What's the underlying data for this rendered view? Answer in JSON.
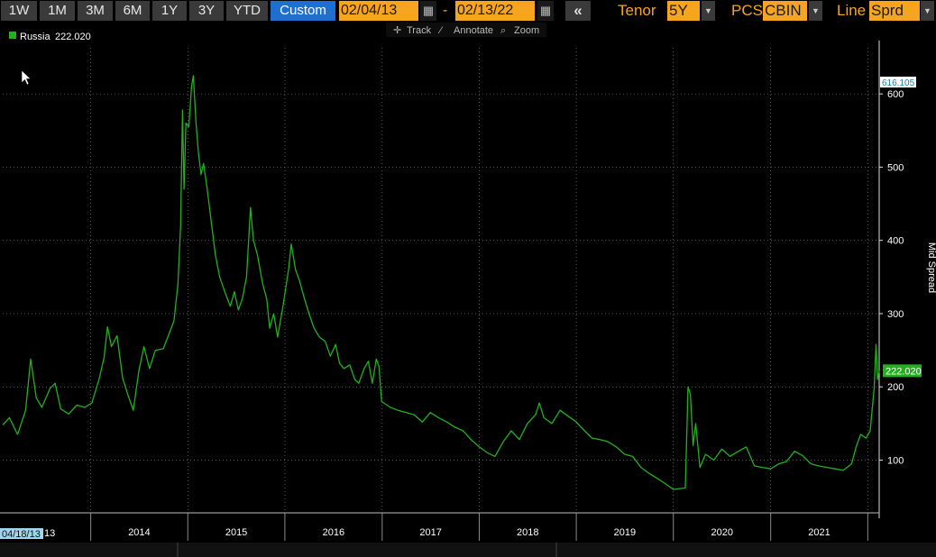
{
  "toolbar": {
    "ranges": [
      "1W",
      "1M",
      "3M",
      "6M",
      "1Y",
      "3Y",
      "YTD",
      "Custom"
    ],
    "active_range": "Custom",
    "start_date": "02/04/13",
    "end_date": "02/13/22",
    "date_separator": "-",
    "tenor_label": "Tenor",
    "tenor_value": "5Y",
    "pcs_label": "PCS",
    "pcs_value": "CBIN",
    "line_label": "Line",
    "line_value": "Sprd",
    "back_glyph": "«",
    "calendar_icon": "calendar-icon",
    "dropdown_icon": "chevron-down-icon"
  },
  "chart_tools": {
    "track": "Track",
    "annotate": "Annotate",
    "zoom": "Zoom"
  },
  "colors": {
    "series": "#22b01e",
    "accent": "#f7a51f",
    "active": "#1f6fd1",
    "background": "#000000"
  },
  "chart_data": {
    "type": "line",
    "series": [
      {
        "name": "Russia",
        "last_value_label": "222.020",
        "points": [
          [
            "2013-02-04",
            148
          ],
          [
            "2013-03-01",
            158
          ],
          [
            "2013-04-01",
            135
          ],
          [
            "2013-05-01",
            168
          ],
          [
            "2013-05-20",
            238
          ],
          [
            "2013-06-10",
            185
          ],
          [
            "2013-07-01",
            172
          ],
          [
            "2013-08-01",
            198
          ],
          [
            "2013-08-20",
            205
          ],
          [
            "2013-09-10",
            170
          ],
          [
            "2013-10-10",
            163
          ],
          [
            "2013-11-10",
            175
          ],
          [
            "2013-12-10",
            172
          ],
          [
            "2014-01-05",
            178
          ],
          [
            "2014-02-01",
            210
          ],
          [
            "2014-02-20",
            240
          ],
          [
            "2014-03-05",
            282
          ],
          [
            "2014-03-20",
            255
          ],
          [
            "2014-04-10",
            270
          ],
          [
            "2014-05-01",
            212
          ],
          [
            "2014-05-20",
            190
          ],
          [
            "2014-06-10",
            168
          ],
          [
            "2014-07-01",
            222
          ],
          [
            "2014-07-20",
            255
          ],
          [
            "2014-08-10",
            225
          ],
          [
            "2014-09-01",
            250
          ],
          [
            "2014-10-01",
            252
          ],
          [
            "2014-10-20",
            270
          ],
          [
            "2014-11-10",
            290
          ],
          [
            "2014-11-25",
            340
          ],
          [
            "2014-12-05",
            420
          ],
          [
            "2014-12-12",
            578
          ],
          [
            "2014-12-18",
            470
          ],
          [
            "2014-12-25",
            560
          ],
          [
            "2015-01-05",
            555
          ],
          [
            "2015-01-15",
            610
          ],
          [
            "2015-01-22",
            625
          ],
          [
            "2015-02-01",
            560
          ],
          [
            "2015-02-10",
            520
          ],
          [
            "2015-02-20",
            490
          ],
          [
            "2015-03-01",
            505
          ],
          [
            "2015-03-15",
            470
          ],
          [
            "2015-04-01",
            420
          ],
          [
            "2015-04-15",
            380
          ],
          [
            "2015-05-01",
            350
          ],
          [
            "2015-05-20",
            330
          ],
          [
            "2015-06-10",
            310
          ],
          [
            "2015-06-25",
            330
          ],
          [
            "2015-07-10",
            305
          ],
          [
            "2015-07-25",
            320
          ],
          [
            "2015-08-10",
            350
          ],
          [
            "2015-08-25",
            445
          ],
          [
            "2015-09-05",
            400
          ],
          [
            "2015-09-20",
            380
          ],
          [
            "2015-10-10",
            340
          ],
          [
            "2015-10-25",
            320
          ],
          [
            "2015-11-05",
            280
          ],
          [
            "2015-11-20",
            300
          ],
          [
            "2015-12-05",
            268
          ],
          [
            "2015-12-25",
            310
          ],
          [
            "2016-01-15",
            360
          ],
          [
            "2016-01-25",
            395
          ],
          [
            "2016-02-10",
            360
          ],
          [
            "2016-02-25",
            345
          ],
          [
            "2016-03-15",
            320
          ],
          [
            "2016-04-01",
            300
          ],
          [
            "2016-04-20",
            280
          ],
          [
            "2016-05-10",
            268
          ],
          [
            "2016-06-01",
            262
          ],
          [
            "2016-06-20",
            242
          ],
          [
            "2016-07-10",
            258
          ],
          [
            "2016-07-25",
            232
          ],
          [
            "2016-08-10",
            225
          ],
          [
            "2016-09-01",
            230
          ],
          [
            "2016-09-20",
            210
          ],
          [
            "2016-10-05",
            205
          ],
          [
            "2016-10-25",
            225
          ],
          [
            "2016-11-10",
            235
          ],
          [
            "2016-11-25",
            205
          ],
          [
            "2016-12-10",
            238
          ],
          [
            "2016-12-20",
            228
          ],
          [
            "2016-12-30",
            180
          ],
          [
            "2017-02-01",
            172
          ],
          [
            "2017-03-01",
            168
          ],
          [
            "2017-04-01",
            165
          ],
          [
            "2017-05-01",
            162
          ],
          [
            "2017-06-01",
            152
          ],
          [
            "2017-07-01",
            165
          ],
          [
            "2017-08-01",
            158
          ],
          [
            "2017-09-01",
            152
          ],
          [
            "2017-10-01",
            145
          ],
          [
            "2017-11-01",
            140
          ],
          [
            "2017-12-01",
            128
          ],
          [
            "2018-01-01",
            118
          ],
          [
            "2018-02-01",
            110
          ],
          [
            "2018-03-01",
            105
          ],
          [
            "2018-04-01",
            125
          ],
          [
            "2018-05-01",
            140
          ],
          [
            "2018-06-01",
            128
          ],
          [
            "2018-07-01",
            150
          ],
          [
            "2018-08-01",
            162
          ],
          [
            "2018-08-15",
            178
          ],
          [
            "2018-09-01",
            158
          ],
          [
            "2018-10-01",
            150
          ],
          [
            "2018-11-01",
            168
          ],
          [
            "2018-12-01",
            160
          ],
          [
            "2019-01-01",
            152
          ],
          [
            "2019-02-01",
            140
          ],
          [
            "2019-03-01",
            130
          ],
          [
            "2019-04-01",
            128
          ],
          [
            "2019-05-01",
            125
          ],
          [
            "2019-06-01",
            118
          ],
          [
            "2019-07-01",
            108
          ],
          [
            "2019-08-01",
            105
          ],
          [
            "2019-09-01",
            90
          ],
          [
            "2019-10-01",
            82
          ],
          [
            "2019-11-01",
            75
          ],
          [
            "2019-12-01",
            68
          ],
          [
            "2020-01-01",
            60
          ],
          [
            "2020-02-15",
            62
          ],
          [
            "2020-02-25",
            200
          ],
          [
            "2020-03-05",
            190
          ],
          [
            "2020-03-15",
            120
          ],
          [
            "2020-03-25",
            150
          ],
          [
            "2020-04-10",
            90
          ],
          [
            "2020-05-01",
            108
          ],
          [
            "2020-06-01",
            100
          ],
          [
            "2020-07-01",
            115
          ],
          [
            "2020-08-01",
            105
          ],
          [
            "2020-09-01",
            112
          ],
          [
            "2020-10-01",
            118
          ],
          [
            "2020-11-01",
            92
          ],
          [
            "2020-12-01",
            90
          ],
          [
            "2021-01-01",
            88
          ],
          [
            "2021-02-01",
            95
          ],
          [
            "2021-03-01",
            98
          ],
          [
            "2021-04-01",
            112
          ],
          [
            "2021-05-01",
            106
          ],
          [
            "2021-06-01",
            95
          ],
          [
            "2021-07-01",
            92
          ],
          [
            "2021-08-01",
            90
          ],
          [
            "2021-09-01",
            88
          ],
          [
            "2021-10-01",
            86
          ],
          [
            "2021-11-01",
            95
          ],
          [
            "2021-11-20",
            120
          ],
          [
            "2021-12-05",
            135
          ],
          [
            "2021-12-25",
            130
          ],
          [
            "2022-01-10",
            140
          ],
          [
            "2022-01-25",
            198
          ],
          [
            "2022-02-01",
            258
          ],
          [
            "2022-02-07",
            210
          ],
          [
            "2022-02-13",
            222
          ]
        ]
      }
    ],
    "xlim": [
      "2013-02-04",
      "2022-02-13"
    ],
    "x_tick_labels": [
      "2014",
      "2015",
      "2016",
      "2017",
      "2018",
      "2019",
      "2020",
      "2021"
    ],
    "x_start_label": "04/18/13",
    "y_ticks": [
      100,
      200,
      300,
      400,
      500,
      600
    ],
    "ylim": [
      28,
      663
    ],
    "ylabel": "Mid Spread",
    "max_marker_label": "616.105",
    "last_value": 222.02,
    "legend_position": "top-left",
    "grid": true
  }
}
